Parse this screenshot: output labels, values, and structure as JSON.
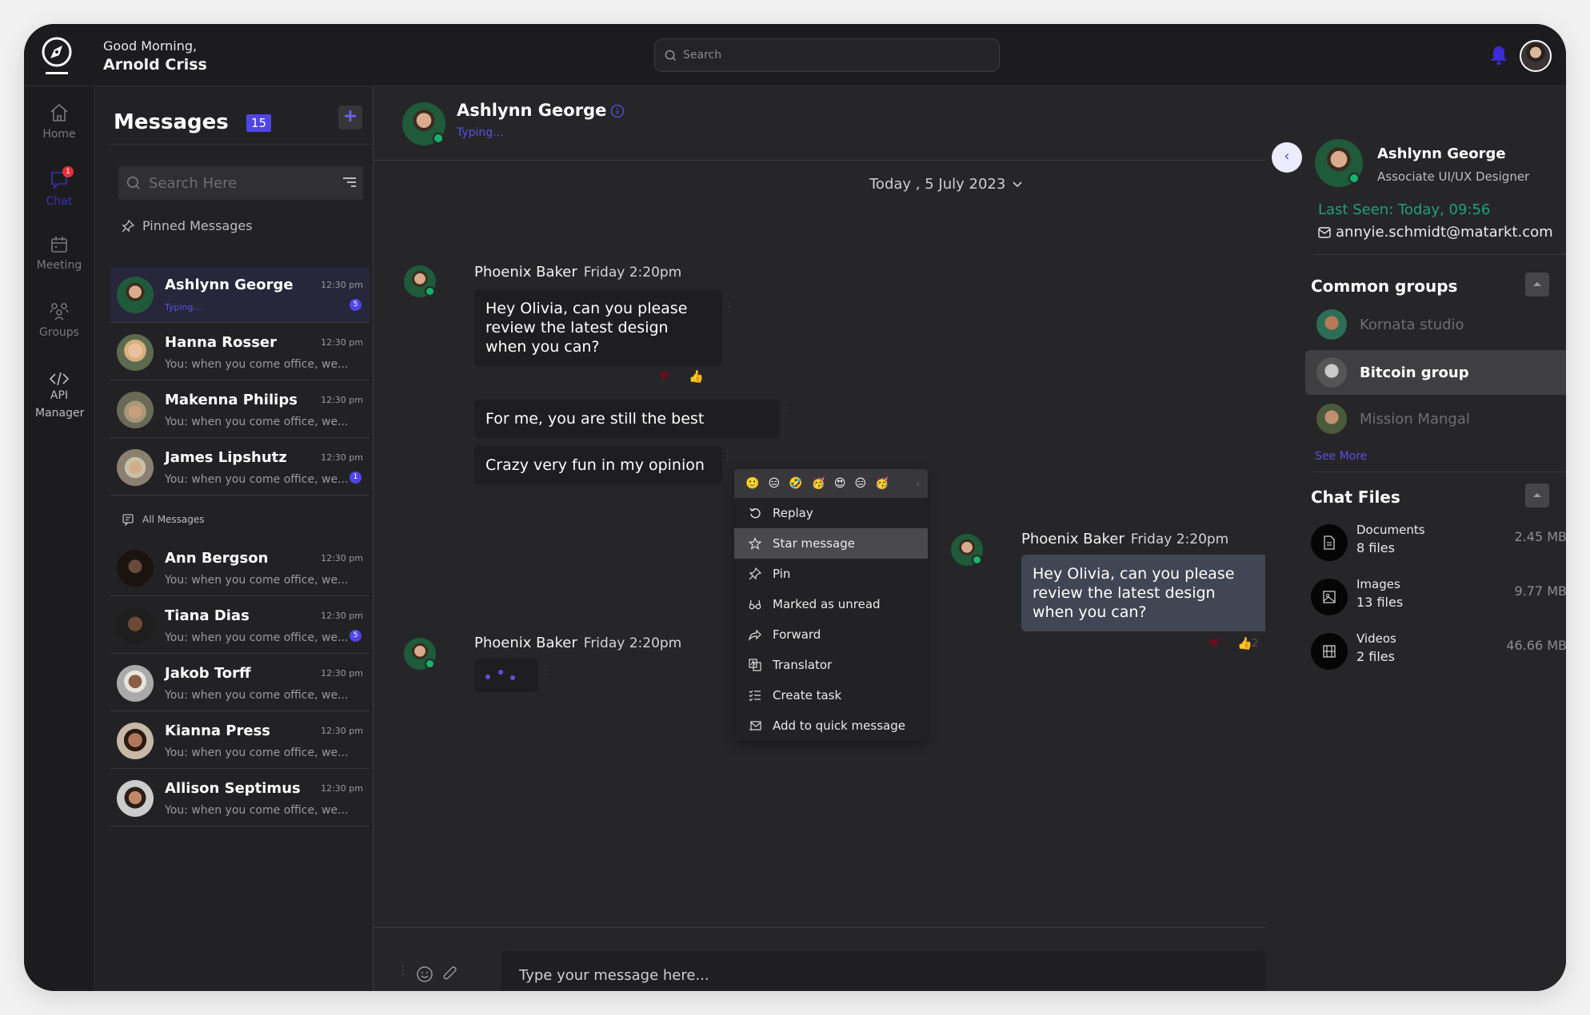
{
  "header": {
    "greeting": "Good Morning,",
    "user_name": "Arnold Criss",
    "search_placeholder": "Search"
  },
  "sidebar": {
    "items": [
      {
        "label": "Home",
        "icon": "home-icon"
      },
      {
        "label": "Chat",
        "icon": "chat-icon",
        "badge": "1",
        "active": true
      },
      {
        "label": "Meeting",
        "icon": "calendar-icon"
      },
      {
        "label": "Groups",
        "icon": "groups-icon"
      },
      {
        "label": "API Manager",
        "icon": "code-icon"
      }
    ]
  },
  "messages_panel": {
    "title": "Messages",
    "count": "15",
    "search_placeholder": "Search Here",
    "pinned_label": "Pinned Messages",
    "all_label": "All Messages",
    "pinned": [
      {
        "name": "Ashlynn George",
        "preview": "Typing...",
        "time": "12:30 pm",
        "badge": "5",
        "typing": true
      },
      {
        "name": "Hanna Rosser",
        "preview": "You: when you come office, we...",
        "time": "12:30 pm"
      },
      {
        "name": "Makenna Philips",
        "preview": "You: when you come office, we...",
        "time": "12:30 pm"
      },
      {
        "name": "James Lipshutz",
        "preview": "You: when you come office, we...",
        "time": "12:30 pm",
        "badge": "1"
      }
    ],
    "all": [
      {
        "name": "Ann Bergson",
        "preview": "You: when you come office, we...",
        "time": "12:30 pm"
      },
      {
        "name": "Tiana Dias",
        "preview": "You: when you come office, we...",
        "time": "12:30 pm",
        "badge": "5"
      },
      {
        "name": "Jakob Torff",
        "preview": "You: when you come office, we...",
        "time": "12:30 pm"
      },
      {
        "name": "Kianna Press",
        "preview": "You: when you come office, we...",
        "time": "12:30 pm"
      },
      {
        "name": "Allison Septimus",
        "preview": "You: when you come office, we...",
        "time": "12:30 pm"
      }
    ]
  },
  "chat": {
    "contact_name": "Ashlynn George",
    "contact_status": "Typing...",
    "date_label": "Today , 5 July 2023",
    "messages": [
      {
        "sender": "Phoenix Baker",
        "time": "Friday 2:20pm",
        "text": "Hey Olivia, can you please review the latest design when you can?"
      },
      {
        "text": "For me, you are still the best"
      },
      {
        "text": "Crazy very fun in my opinion"
      },
      {
        "sender": "Phoenix Baker",
        "time": "Friday 2:20pm",
        "text": "Hey Olivia, can you please review the latest design when you can?",
        "reaction_count": "2"
      },
      {
        "sender": "Phoenix Baker",
        "time": "Friday 2:20pm",
        "typing": true
      }
    ],
    "context_menu": {
      "emojis": [
        "🙂",
        "😑",
        "🤣",
        "🥳",
        "😍",
        "😑",
        "🥳"
      ],
      "items": [
        "Replay",
        "Star message",
        "Pin",
        "Marked as unread",
        "Forward",
        "Translator",
        "Create task",
        "Add to quick message"
      ],
      "highlighted": "Star message"
    },
    "composer_placeholder": "Type your message here..."
  },
  "profile": {
    "name": "Ashlynn George",
    "role": "Associate UI/UX Designer",
    "last_seen": "Last Seen: Today, 09:56",
    "email": "annyie.schmidt@matarkt.com",
    "groups_title": "Common groups",
    "groups": [
      "Kornata studio",
      "Bitcoin group",
      "Mission Mangal"
    ],
    "active_group": "Bitcoin group",
    "see_more": "See More",
    "files_title": "Chat Files",
    "files": [
      {
        "type": "Documents",
        "count": "8 files",
        "size": "2.45 MB",
        "icon": "document-icon"
      },
      {
        "type": "Images",
        "count": "13 files",
        "size": "9.77 MB",
        "icon": "image-icon"
      },
      {
        "type": "Videos",
        "count": "2 files",
        "size": "46.66 MB",
        "icon": "video-icon"
      }
    ]
  },
  "colors": {
    "accent": "#4f46e5",
    "online": "#17b26a",
    "last_seen": "#1fa07a",
    "badge_red": "#e5303a"
  }
}
